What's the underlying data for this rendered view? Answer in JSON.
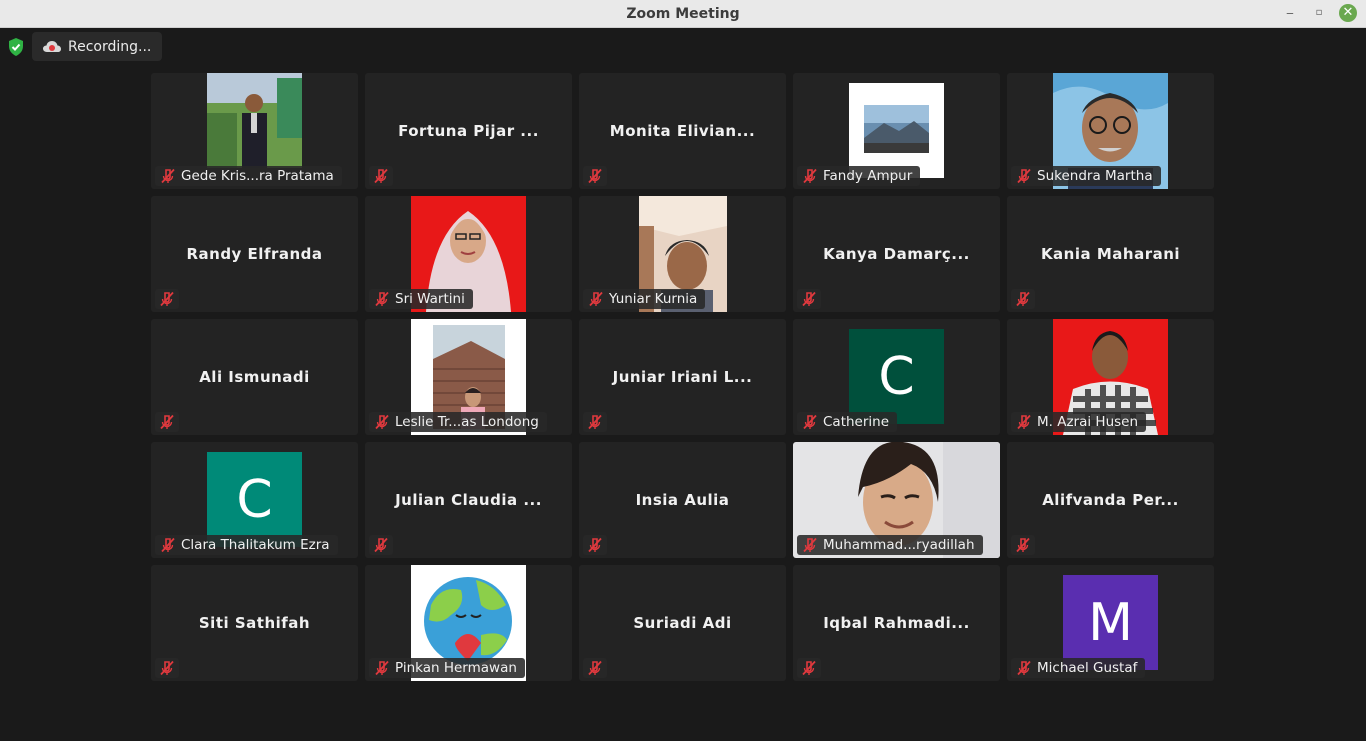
{
  "window": {
    "title": "Zoom Meeting",
    "minimize_glyph": "‒",
    "maximize_glyph": "▫",
    "close_glyph": "✕"
  },
  "recording": {
    "label": "Recording..."
  },
  "colors": {
    "avatar_catherine": "#00503c",
    "avatar_clara": "#008a78",
    "avatar_michael": "#5a2eb0"
  },
  "participants": [
    {
      "name": "Gede Kris...ra Pratama",
      "has_video": true
    },
    {
      "name": "Fortuna Pijar ...",
      "has_video": false
    },
    {
      "name": "Monita Elivian...",
      "has_video": false
    },
    {
      "name": "Fandy Ampur",
      "has_video": true
    },
    {
      "name": "Sukendra Martha",
      "has_video": true
    },
    {
      "name": "Randy Elfranda",
      "has_video": false
    },
    {
      "name": "Sri Wartini",
      "has_video": true
    },
    {
      "name": "Yuniar Kurnia",
      "has_video": true
    },
    {
      "name": "Kanya Damarç...",
      "has_video": false
    },
    {
      "name": "Kania Maharani",
      "has_video": false
    },
    {
      "name": "Ali Ismunadi",
      "has_video": false
    },
    {
      "name": "Leslie Tr...as Londong",
      "has_video": true
    },
    {
      "name": "Juniar Iriani L...",
      "has_video": false
    },
    {
      "name": "Catherine",
      "has_video": true,
      "avatar_letter": "C"
    },
    {
      "name": "M. Azrai Husen",
      "has_video": true
    },
    {
      "name": "Clara Thalitakum Ezra",
      "has_video": true,
      "avatar_letter": "C"
    },
    {
      "name": "Julian Claudia ...",
      "has_video": false
    },
    {
      "name": "Insia Aulia",
      "has_video": false
    },
    {
      "name": "Muhammad...ryadillah",
      "has_video": true
    },
    {
      "name": "Alifvanda Per...",
      "has_video": false
    },
    {
      "name": "Siti Sathifah",
      "has_video": false
    },
    {
      "name": "Pinkan Hermawan",
      "has_video": true
    },
    {
      "name": "Suriadi Adi",
      "has_video": false
    },
    {
      "name": "Iqbal Rahmadi...",
      "has_video": false
    },
    {
      "name": "Michael Gustaf",
      "has_video": true,
      "avatar_letter": "M"
    }
  ]
}
